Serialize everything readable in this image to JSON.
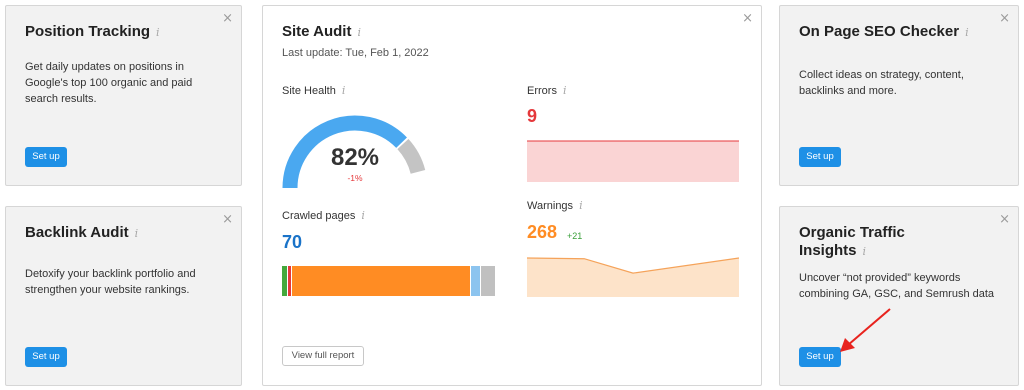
{
  "cards": {
    "position_tracking": {
      "title": "Position Tracking",
      "info": "i",
      "close": "×",
      "desc_lines": [
        "Get daily updates on positions in",
        "Google's top 100 organic and paid",
        "search results."
      ],
      "button": "Set up"
    },
    "backlink_audit": {
      "title": "Backlink Audit",
      "info": "i",
      "close": "×",
      "desc_lines": [
        "Detoxify your backlink portfolio and",
        "strengthen your website rankings."
      ],
      "button": "Set up"
    },
    "on_page_seo": {
      "title": "On Page SEO Checker",
      "info": "i",
      "close": "×",
      "desc_lines": [
        "Collect ideas on strategy, content,",
        "backlinks and more."
      ],
      "button": "Set up"
    },
    "organic_traffic": {
      "title_lines": [
        "Organic Traffic",
        "Insights"
      ],
      "info": "i",
      "close": "×",
      "desc_lines": [
        "Uncover “not provided” keywords",
        "combining GA, GSC, and Semrush data"
      ],
      "button": "Set up"
    }
  },
  "site_audit": {
    "title": "Site Audit",
    "info": "i",
    "close": "×",
    "last_update": "Last update: Tue, Feb 1, 2022",
    "site_health": {
      "label": "Site Health",
      "value": "82%",
      "value_fraction": 0.82,
      "delta": "-1%",
      "colors": {
        "filled": "#4aa8f0",
        "rest": "#c4c4c4"
      }
    },
    "errors": {
      "label": "Errors",
      "value": "9",
      "color": "#e5383b",
      "fill": "#fad4d4"
    },
    "crawled_pages": {
      "label": "Crawled pages",
      "value": "70",
      "color": "#1a73c8",
      "segments": [
        {
          "name": "healthy",
          "share": 3,
          "color": "#44a83c"
        },
        {
          "name": "broken",
          "share": 1.5,
          "color": "#e5383b"
        },
        {
          "name": "have-issues",
          "share": 84,
          "color": "#ff8c23"
        },
        {
          "name": "redirected",
          "share": 4.5,
          "color": "#8cc4ef"
        },
        {
          "name": "blocked",
          "share": 7,
          "color": "#c0c0c0"
        }
      ]
    },
    "warnings": {
      "label": "Warnings",
      "value": "268",
      "delta": "+21",
      "color": "#ff8c23",
      "delta_color": "#3aa03a",
      "fill": "#fde3c9",
      "stroke": "#f5a35a",
      "trend": [
        268,
        267,
        247,
        268
      ]
    },
    "view_button": "View full report"
  }
}
